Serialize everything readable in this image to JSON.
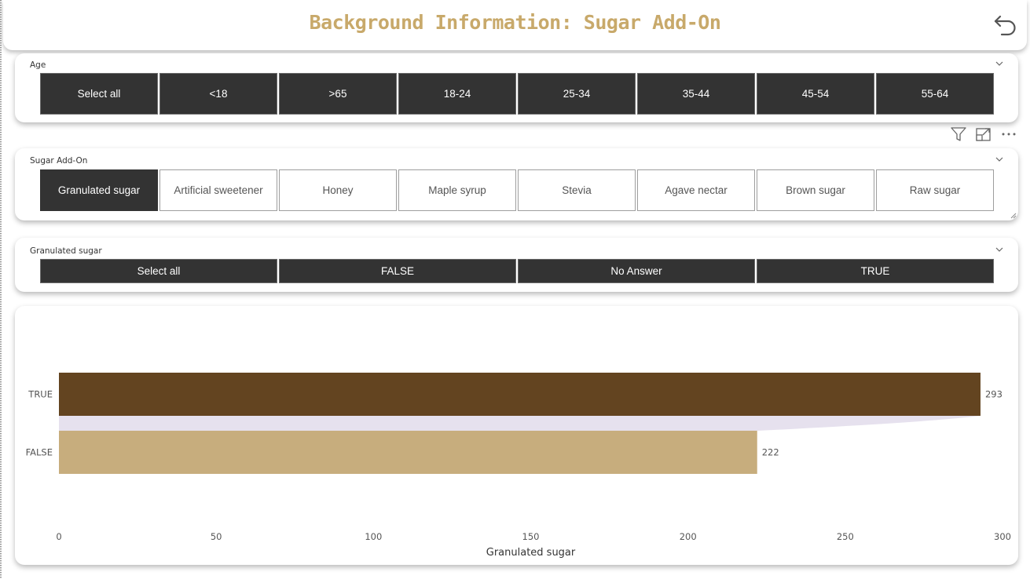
{
  "header": {
    "title": "Background Information: Sugar Add-On",
    "back_icon": "undo-arrow-icon"
  },
  "age_slicer": {
    "title": "Age",
    "options": [
      "Select all",
      "<18",
      ">65",
      "18-24",
      "25-34",
      "35-44",
      "45-54",
      "55-64"
    ],
    "selected": []
  },
  "sugar_slicer": {
    "title": "Sugar Add-On",
    "options": [
      "Granulated sugar",
      "Artificial sweetener",
      "Honey",
      "Maple syrup",
      "Stevia",
      "Agave nectar",
      "Brown sugar",
      "Raw sugar"
    ],
    "selected": "Granulated sugar"
  },
  "granulated_slicer": {
    "title": "Granulated sugar",
    "options": [
      "Select all",
      "FALSE",
      "No Answer",
      "TRUE"
    ]
  },
  "visual_toolbar": {
    "icons": [
      "filter-icon",
      "focus-mode-icon",
      "more-options-icon"
    ]
  },
  "chart_data": {
    "type": "bar",
    "orientation": "horizontal",
    "categories": [
      "TRUE",
      "FALSE"
    ],
    "values": [
      293,
      222
    ],
    "data_labels": [
      "293",
      "222"
    ],
    "colors": [
      "#634420",
      "#c7ad7d"
    ],
    "xlabel": "Granulated sugar",
    "ylabel": "",
    "xlim": [
      0,
      300
    ],
    "x_ticks": [
      0,
      50,
      100,
      150,
      200,
      250,
      300
    ],
    "x_tick_labels": [
      "0",
      "50",
      "100",
      "150",
      "200",
      "250",
      "300"
    ],
    "grid": false
  }
}
